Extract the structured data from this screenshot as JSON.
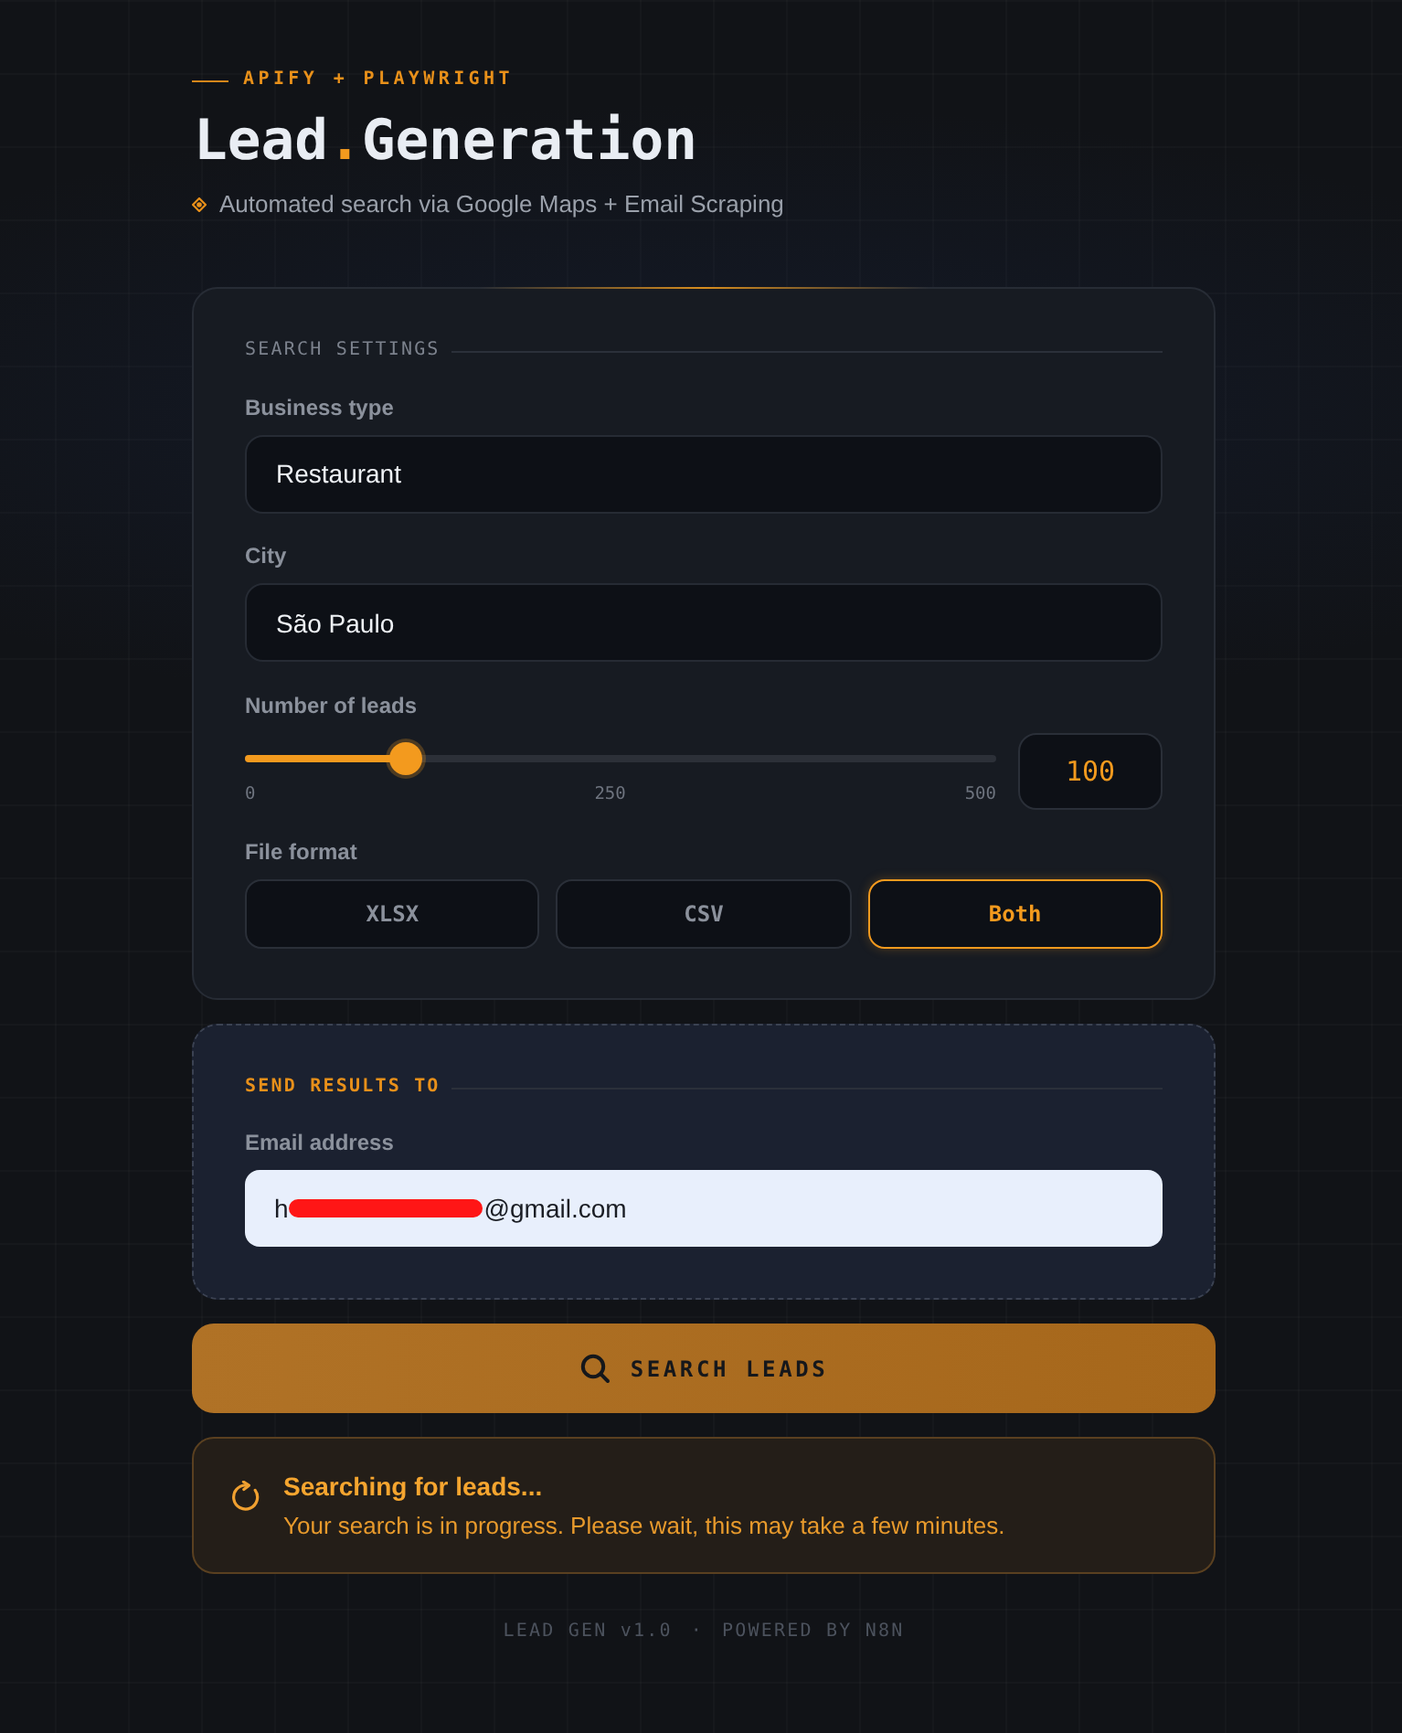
{
  "header": {
    "eyebrow": "APIFY + PLAYWRIGHT",
    "title_parts": [
      {
        "text": "Lead",
        "accent": false
      },
      {
        "text": ".",
        "accent": true
      },
      {
        "text": "Generation",
        "accent": false
      }
    ],
    "subtitle": "Automated search via Google Maps + Email Scraping"
  },
  "search_settings": {
    "heading": "SEARCH SETTINGS",
    "fields": [
      {
        "label": "Business type",
        "value": "Restaurant"
      },
      {
        "label": "City",
        "value": "São Paulo"
      }
    ],
    "leads": {
      "label": "Number of leads",
      "level": 0.2,
      "ticks": [
        "0",
        "250",
        "500"
      ],
      "value": "100"
    },
    "file_format": {
      "label": "File format",
      "options": [
        {
          "label": "XLSX",
          "selected": false
        },
        {
          "label": "CSV",
          "selected": false
        },
        {
          "label": "Both",
          "selected": true
        }
      ]
    }
  },
  "send_results": {
    "heading": "SEND RESULTS TO",
    "email": {
      "label": "Email address",
      "value_start": "h",
      "value_end": "@gmail.com",
      "redacted": true
    }
  },
  "search_button": {
    "label": "SEARCH LEADS"
  },
  "status": {
    "title": "Searching for leads...",
    "message": "Your search is in progress. Please wait, this may take a few minutes."
  },
  "footer": {
    "version": "LEAD GEN v1.0",
    "separator": "·",
    "powered_by": "POWERED BY N8N"
  }
}
